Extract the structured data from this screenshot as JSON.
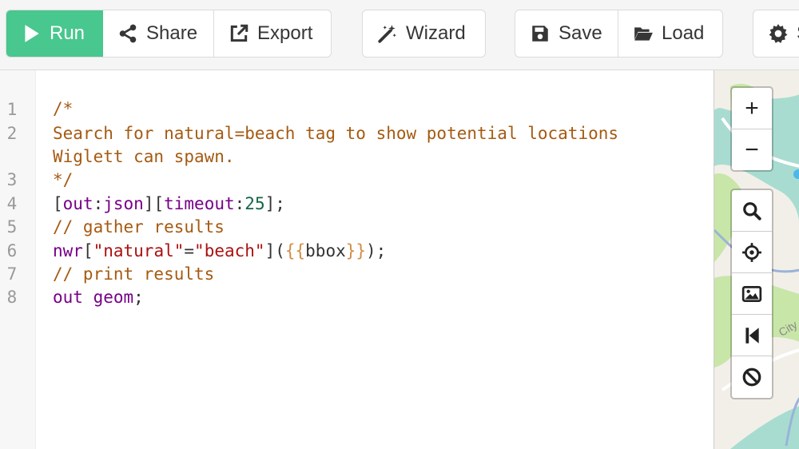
{
  "toolbar": {
    "run_label": "Run",
    "share_label": "Share",
    "export_label": "Export",
    "wizard_label": "Wizard",
    "save_label": "Save",
    "load_label": "Load",
    "settings_label": "S"
  },
  "editor": {
    "line_numbers": [
      "1",
      "2",
      "3",
      "4",
      "5",
      "6",
      "7",
      "8"
    ],
    "lines": {
      "l1": "/*",
      "l2a": "Search for natural=beach tag to show potential locations",
      "l2b": "Wiglett can spawn.",
      "l3": "*/",
      "l4": {
        "b1": "[",
        "k1": "out",
        "c1": ":",
        "k2": "json",
        "b2": "][",
        "k3": "timeout",
        "c2": ":",
        "n1": "25",
        "b3": "];"
      },
      "l5": "// gather results",
      "l6": {
        "k1": "nwr",
        "b1": "[",
        "s1": "\"natural\"",
        "eq": "=",
        "s2": "\"beach\"",
        "b2": "](",
        "t1": "{{",
        "t2": "bbox",
        "t3": "}}",
        "b3": ");"
      },
      "l7": "// print results",
      "l8": {
        "k1": "out",
        "sp": " ",
        "k2": "geom",
        "sc": ";"
      }
    }
  },
  "map_controls": {
    "zoom_in": "+",
    "zoom_out": "−",
    "map_label": "City"
  },
  "colors": {
    "run_button": "#48c78e",
    "comment": "#a55a12",
    "keyword": "#770088",
    "string": "#aa1111",
    "number": "#116644",
    "template": "#d08c46",
    "map_water": "#a8dcd1",
    "map_land": "#f2efe9"
  }
}
